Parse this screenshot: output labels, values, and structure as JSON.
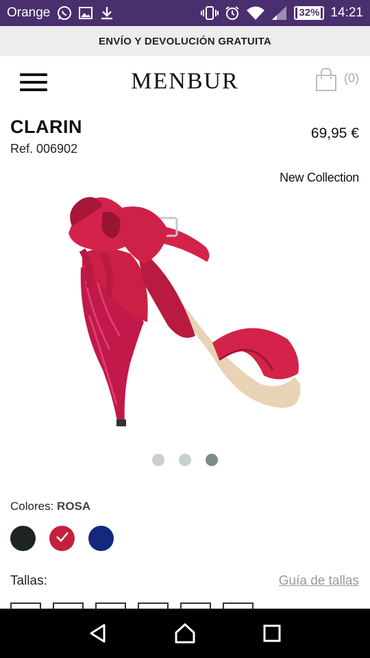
{
  "status_bar": {
    "carrier": "Orange",
    "battery": "32%",
    "time": "14:21",
    "icons_left": [
      "whatsapp-icon",
      "image-icon",
      "download-icon"
    ],
    "icons_right": [
      "vibrate-icon",
      "alarm-icon",
      "wifi-icon",
      "signal-icon",
      "battery-icon"
    ]
  },
  "promo": {
    "text": "ENVÍO Y DEVOLUCIÓN GRATUITA"
  },
  "header": {
    "logo": "MENBUR",
    "cart_count": "(0)"
  },
  "product": {
    "name": "CLARIN",
    "ref": "Ref. 006902",
    "price": "69,95 €",
    "badge": "New Collection",
    "image_dots": 3,
    "active_dot": 3
  },
  "colors": {
    "label": "Colores:",
    "selected": "ROSA",
    "swatches": [
      {
        "name": "black",
        "hex": "#1e2323",
        "selected": false
      },
      {
        "name": "rosa",
        "hex": "#c4203c",
        "selected": true
      },
      {
        "name": "blue",
        "hex": "#14287c",
        "selected": false
      }
    ]
  },
  "sizes": {
    "label": "Tallas:",
    "guide": "Guía de tallas",
    "count": 6
  },
  "theme": {
    "status_bar_bg": "#4a2f6e",
    "promo_bg": "#ededed",
    "shoe_red": "#d4234a"
  }
}
